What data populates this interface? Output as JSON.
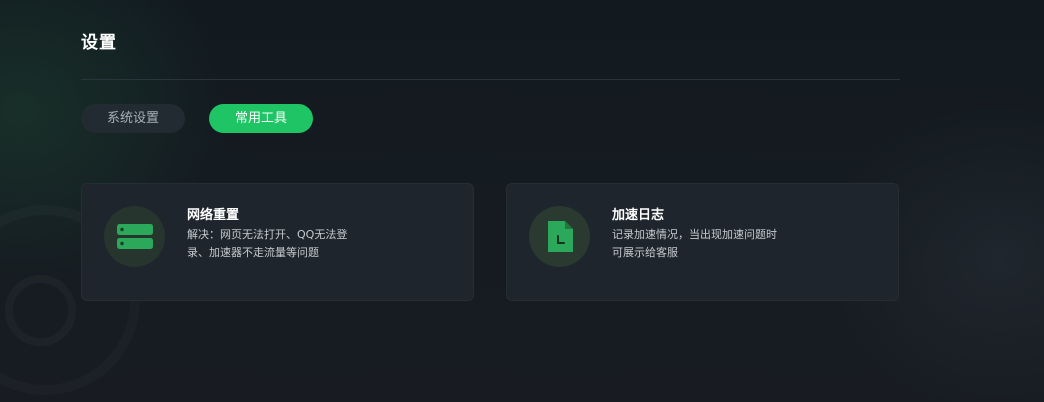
{
  "page": {
    "title": "设置"
  },
  "tabs": [
    {
      "label": "系统设置",
      "active": false
    },
    {
      "label": "常用工具",
      "active": true
    }
  ],
  "tools": [
    {
      "title": "网络重置",
      "desc_lines": [
        "解决：网页无法打开、QQ无法登",
        "录、加速器不走流量等问题"
      ],
      "icon": "server-icon"
    },
    {
      "title": "加速日志",
      "desc_lines": [
        "记录加速情况，当出现加速问题时",
        "可展示给客服"
      ],
      "icon": "log-file-icon"
    }
  ],
  "colors": {
    "accent": "#1fc564",
    "background": "#151b21",
    "card": "#1e252c"
  }
}
